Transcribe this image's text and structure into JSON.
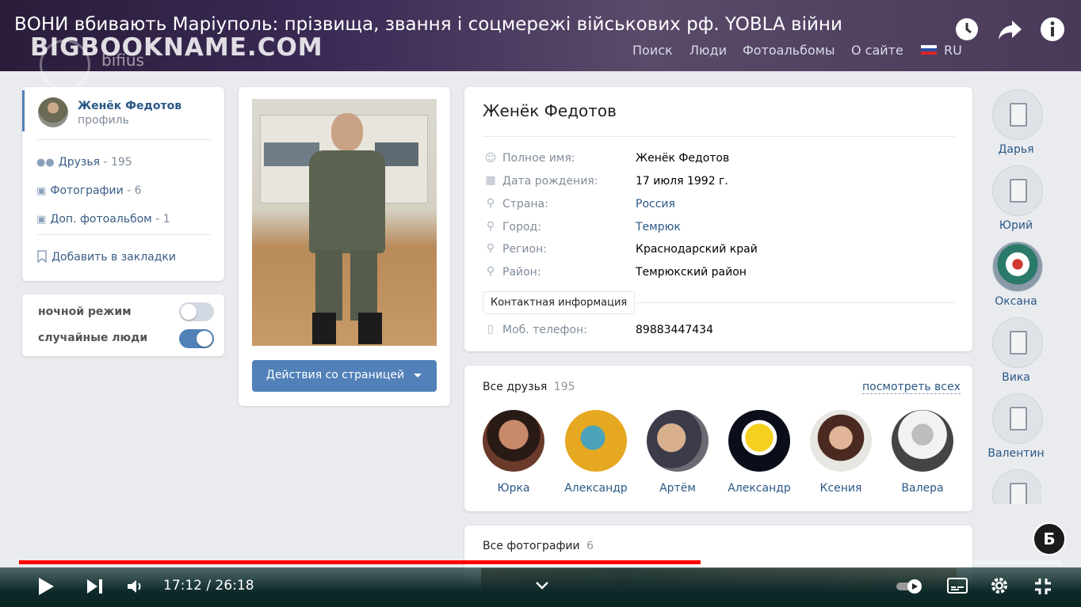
{
  "video": {
    "title": "ВОНИ вбивають Маріуполь: прізвища, звання і соцмережі військових рф. YOBLA війни",
    "time_current": "17:12",
    "time_total": "26:18",
    "time_display": "17:12 / 26:18",
    "progress": 0.6535,
    "buffered": 0.683,
    "channel_badge": "Б"
  },
  "site": {
    "logo": "BIGBOOKNAME.COM",
    "logo_sub": "bifius",
    "nav": [
      "Поиск",
      "Люди",
      "Фотоальбомы",
      "О сайте"
    ],
    "lang": "RU"
  },
  "left_menu": {
    "profile_name": "Женёк Федотов",
    "profile_sub": "профиль",
    "items": [
      {
        "label": "Друзья",
        "count": " - 195"
      },
      {
        "label": "Фотографии",
        "count": " - 6"
      },
      {
        "label": "Доп. фотоальбом",
        "count": " - 1"
      }
    ],
    "bookmark": "Добавить в закладки",
    "toggles": [
      {
        "label": "ночной режим",
        "on": false
      },
      {
        "label": "случайные люди",
        "on": true
      }
    ]
  },
  "photo_card": {
    "action_button": "Действия со страницей"
  },
  "profile": {
    "name": "Женёк Федотов",
    "rows": [
      {
        "label": "Полное имя:",
        "value": "Женёк Федотов"
      },
      {
        "label": "Дата рождения:",
        "value": "17 июля 1992 г."
      },
      {
        "label": "Страна:",
        "value": "Россия"
      },
      {
        "label": "Город:",
        "value": "Темрюк"
      },
      {
        "label": "Регион:",
        "value": "Краснодарский край"
      },
      {
        "label": "Район:",
        "value": "Темрюкский район"
      }
    ],
    "contact_header": "Контактная информация",
    "phone_label": "Моб. телефон:",
    "phone_value": "89883447434"
  },
  "friends": {
    "title": "Все друзья",
    "count": "195",
    "see_all": "посмотреть всех",
    "list": [
      "Юрка",
      "Александр",
      "Артём",
      "Александр",
      "Ксения",
      "Валера"
    ]
  },
  "photos": {
    "title": "Все фотографии",
    "count": "6"
  },
  "side_people": [
    "Дарья",
    "Юрий",
    "Оксана",
    "Вика",
    "Валентин"
  ],
  "colors": {
    "accent": "#5181b8",
    "link": "#2a5885",
    "progress_red": "#ff0000"
  }
}
